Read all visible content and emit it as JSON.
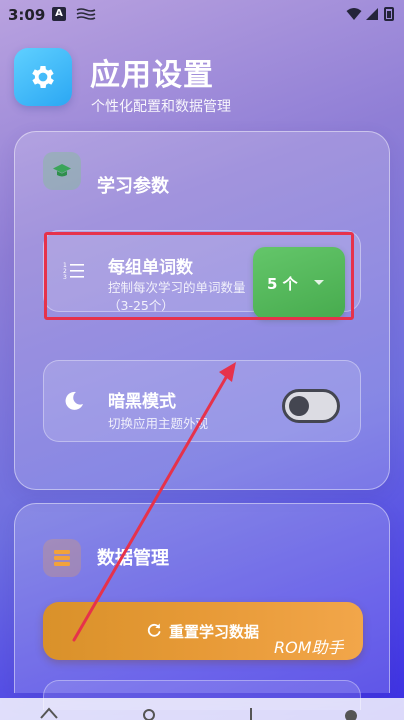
{
  "status_bar": {
    "time": "3:09",
    "notification_icons": [
      "a-badge-icon",
      "signal-lines-icon"
    ],
    "system_icons": [
      "wifi-icon",
      "cellular-icon",
      "battery-icon"
    ]
  },
  "header": {
    "app_icon": "gear-icon",
    "title": "应用设置",
    "subtitle": "个性化配置和数据管理"
  },
  "study_section": {
    "icon": "graduation-cap-icon",
    "title": "学习参数",
    "words_per_group": {
      "icon": "numbered-list-icon",
      "title": "每组单词数",
      "description": "控制每次学习的单词数量（3-25个）",
      "selected_value": "5 个"
    },
    "dark_mode": {
      "icon": "moon-icon",
      "title": "暗黑模式",
      "description": "切换应用主题外观",
      "enabled": false
    }
  },
  "data_section": {
    "icon": "database-icon",
    "title": "数据管理",
    "reset_button_label": "重置学习数据",
    "reset_icon": "refresh-icon"
  },
  "watermark": "ROM助手",
  "annotation": {
    "highlight_color": "#e6324b",
    "arrow_color": "#e6324b"
  },
  "nav_bar": {
    "tabs": [
      "home-icon",
      "search-icon",
      "add-icon",
      "settings-icon"
    ]
  },
  "colors": {
    "dropdown_green": "#4fb556",
    "reset_orange": "#e79a37",
    "app_icon_blue": "#2ba7f3"
  }
}
